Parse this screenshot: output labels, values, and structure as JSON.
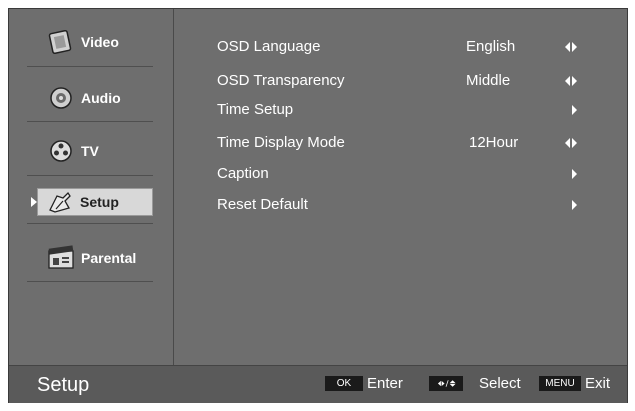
{
  "sidebar": {
    "items": [
      {
        "label": "Video",
        "icon": "video-icon"
      },
      {
        "label": "Audio",
        "icon": "audio-icon"
      },
      {
        "label": "TV",
        "icon": "tv-icon"
      },
      {
        "label": "Setup",
        "icon": "setup-icon",
        "selected": true
      },
      {
        "label": "Parental",
        "icon": "parental-icon"
      }
    ]
  },
  "menu": {
    "rows": [
      {
        "label": "OSD Language",
        "value": "English",
        "control": "left-right"
      },
      {
        "label": "OSD Transparency",
        "value": "Middle",
        "control": "left-right"
      },
      {
        "label": "Time Setup",
        "value": "",
        "control": "right"
      },
      {
        "label": "Time Display Mode",
        "value": "12Hour",
        "control": "left-right"
      },
      {
        "label": "Caption",
        "value": "",
        "control": "right"
      },
      {
        "label": "Reset Default",
        "value": "",
        "control": "right"
      }
    ]
  },
  "footer": {
    "title": "Setup",
    "ok_key": "OK",
    "ok_hint": "Enter",
    "select_key": "◆/◆",
    "select_hint": "Select",
    "menu_key": "MENU",
    "menu_hint": "Exit"
  },
  "colors": {
    "background": "#6e6e6e",
    "selected_item": "#d8d8d8",
    "text": "#ffffff"
  }
}
